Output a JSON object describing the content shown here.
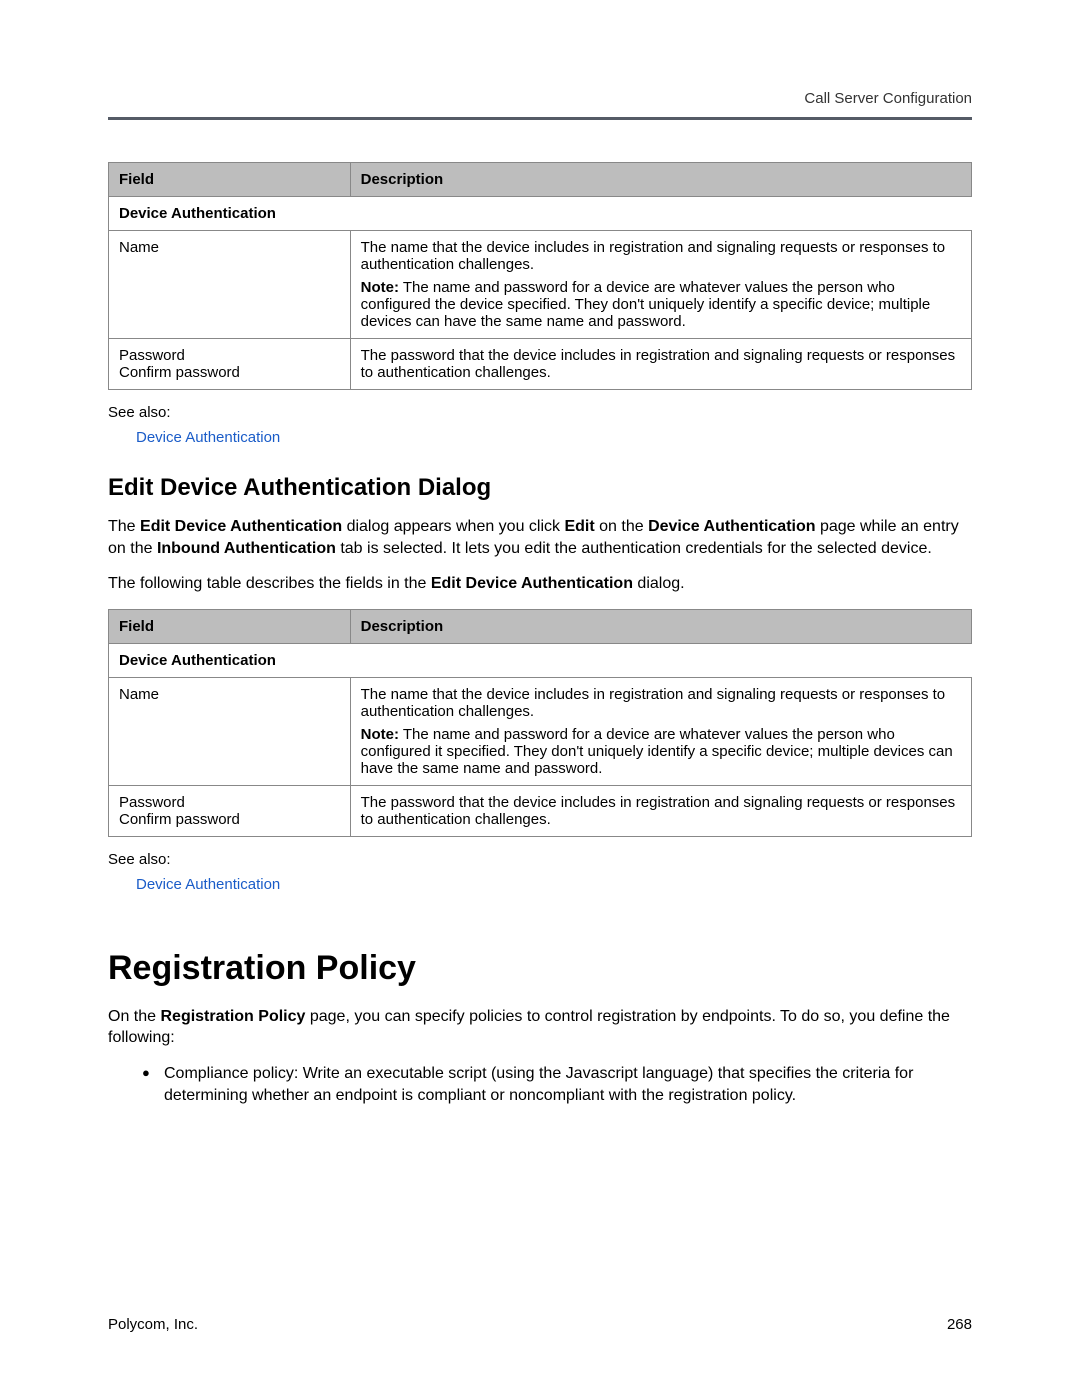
{
  "header": {
    "running_title": "Call Server Configuration"
  },
  "table1": {
    "head_field": "Field",
    "head_desc": "Description",
    "section_label": "Device Authentication",
    "row1_field": "Name",
    "row1_desc_p1": "The name that the device includes in registration and signaling requests or responses to authentication challenges.",
    "row1_note_label": "Note:",
    "row1_note_text": " The name and password for a device are whatever values the person who configured the device specified. They don't uniquely identify a specific device; multiple devices can have the same name and password.",
    "row2_field_l1": "Password",
    "row2_field_l2": "Confirm password",
    "row2_desc": "The password that the device includes in registration and signaling requests or responses to authentication challenges."
  },
  "seealso1": {
    "label": "See also:",
    "link": "Device Authentication"
  },
  "section_edit": {
    "heading": "Edit Device Authentication Dialog",
    "p1_a": "The ",
    "p1_b": "Edit Device Authentication",
    "p1_c": " dialog appears when you click ",
    "p1_d": "Edit",
    "p1_e": " on the ",
    "p1_f": "Device Authentication",
    "p1_g": " page while an entry on the ",
    "p1_h": "Inbound Authentication",
    "p1_i": " tab is selected. It lets you edit the authentication credentials for the selected device.",
    "p2_a": "The following table describes the fields in the ",
    "p2_b": "Edit Device Authentication",
    "p2_c": " dialog."
  },
  "table2": {
    "head_field": "Field",
    "head_desc": "Description",
    "section_label": "Device Authentication",
    "row1_field": "Name",
    "row1_desc_p1": "The name that the device includes in registration and signaling requests or responses to authentication challenges.",
    "row1_note_label": "Note:",
    "row1_note_text": " The name and password for a device are whatever values the person who configured it specified. They don't uniquely identify a specific device; multiple devices can have the same name and password.",
    "row2_field_l1": "Password",
    "row2_field_l2": "Confirm password",
    "row2_desc": "The password that the device includes in registration and signaling requests or responses to authentication challenges."
  },
  "seealso2": {
    "label": "See also:",
    "link": "Device Authentication"
  },
  "section_regpolicy": {
    "heading": "Registration Policy",
    "p1_a": "On the ",
    "p1_b": "Registration Policy",
    "p1_c": " page, you can specify policies to control registration by endpoints. To do so, you define the following:",
    "bullet1_b": "Compliance policy:",
    "bullet1_t1": " Write an executable script (using the Javascript language) that specifies the criteria for determining whether an endpoint is ",
    "bullet1_i1": "compliant",
    "bullet1_t2": " or ",
    "bullet1_i2": "noncompliant",
    "bullet1_t3": " with the registration policy."
  },
  "footer": {
    "left": "Polycom, Inc.",
    "right": "268"
  }
}
